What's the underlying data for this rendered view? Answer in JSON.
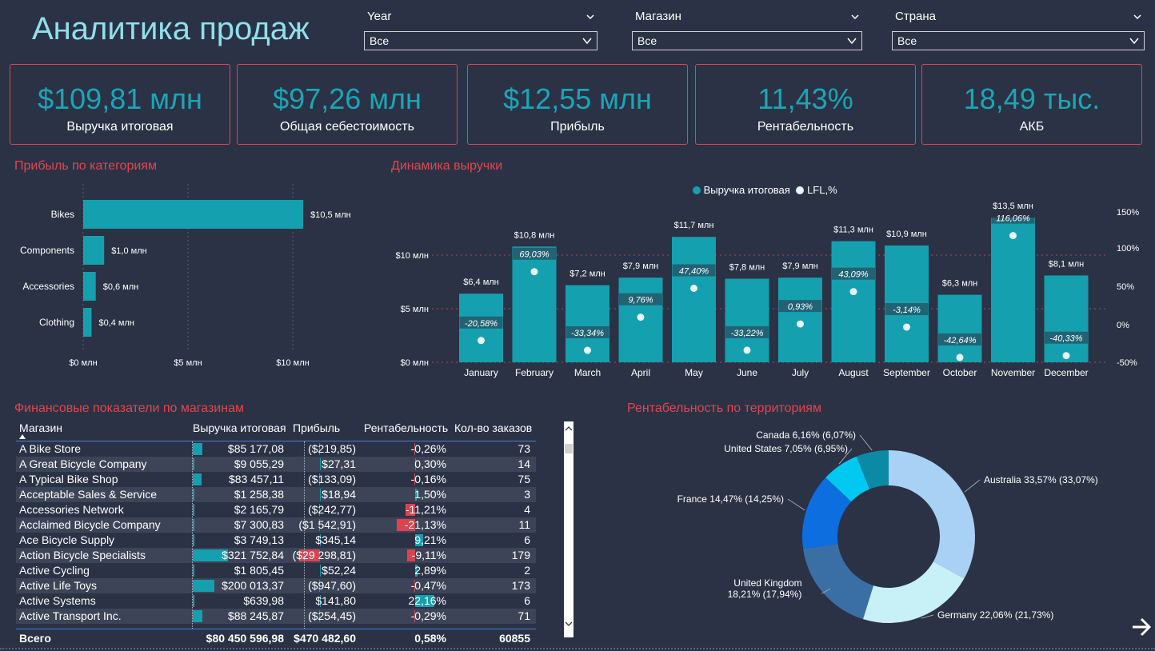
{
  "title": "Аналитика продаж",
  "slicers": [
    {
      "label": "Year",
      "value": "Все"
    },
    {
      "label": "Магазин",
      "value": "Все"
    },
    {
      "label": "Страна",
      "value": "Все"
    }
  ],
  "kpis": [
    {
      "value": "$109,81 млн",
      "label": "Выручка итоговая"
    },
    {
      "value": "$97,26 млн",
      "label": "Общая себестоимость"
    },
    {
      "value": "$12,55 млн",
      "label": "Прибыль"
    },
    {
      "value": "11,43%",
      "label": "Рентабельность"
    },
    {
      "value": "18,49 тыс.",
      "label": "АКБ"
    }
  ],
  "profit_by_category": {
    "title": "Прибыль по категориям",
    "chart_data": {
      "type": "bar",
      "orientation": "horizontal",
      "categories": [
        "Bikes",
        "Components",
        "Accessories",
        "Clothing"
      ],
      "values": [
        10.5,
        1.0,
        0.6,
        0.4
      ],
      "data_labels": [
        "$10,5 млн",
        "$1,0 млн",
        "$0,6 млн",
        "$0,4 млн"
      ],
      "xticks": [
        "$0 млн",
        "$5 млн",
        "$10 млн"
      ],
      "xlim": [
        0,
        10.5
      ],
      "color": "#14a0ae"
    }
  },
  "revenue_dynamics": {
    "title": "Динамика выручки",
    "legend": [
      "Выручка итоговая",
      "LFL,%"
    ],
    "chart_data": {
      "type": "bar",
      "categories": [
        "January",
        "February",
        "March",
        "April",
        "May",
        "June",
        "July",
        "August",
        "September",
        "October",
        "November",
        "December"
      ],
      "series": [
        {
          "name": "Выручка итоговая",
          "values": [
            6.4,
            10.8,
            7.2,
            7.9,
            11.7,
            7.8,
            7.9,
            11.3,
            10.9,
            6.3,
            13.5,
            8.1
          ],
          "labels": [
            "$6,4 млн",
            "$10,8 млн",
            "$7,2 млн",
            "$7,9 млн",
            "$11,7 млн",
            "$7,8 млн",
            "$7,9 млн",
            "$11,3 млн",
            "$10,9 млн",
            "$6,3 млн",
            "$13,5 млн",
            "$8,1 млн"
          ]
        },
        {
          "name": "LFL,%",
          "values": [
            -20.58,
            69.03,
            -33.34,
            9.76,
            47.4,
            -33.22,
            0.93,
            43.09,
            -3.14,
            -42.64,
            116.06,
            -40.33
          ],
          "labels": [
            "-20,58%",
            "69,03%",
            "-33,34%",
            "9,76%",
            "47,40%",
            "-33,22%",
            "0,93%",
            "43,09%",
            "-3,14%",
            "-42,64%",
            "116,06%",
            "-40,33%"
          ]
        }
      ],
      "y_ticks": [
        "$0 млн",
        "$5 млн",
        "$10 млн"
      ],
      "y2_ticks": [
        "-50%",
        "0%",
        "50%",
        "100%",
        "150%"
      ],
      "ylim": [
        0,
        14
      ],
      "y2lim": [
        -50,
        150
      ],
      "colors": {
        "bar": "#14a0ae",
        "point": "#e8f6fb"
      }
    }
  },
  "store_table": {
    "title": "Финансовые показатели по магазинам",
    "columns": [
      "Магазин",
      "Выручка итоговая",
      "Прибыль",
      "Рентабельность",
      "Кол-во заказов"
    ],
    "rows": [
      {
        "store": "A Bike Store",
        "revenue": "$85 177,08",
        "profit": "($219,85)",
        "margin": "-0,26%",
        "orders": "73",
        "rev_v": 85177,
        "prof_v": -219.85,
        "marg_v": -0.26
      },
      {
        "store": "A Great Bicycle Company",
        "revenue": "$9 055,29",
        "profit": "$27,31",
        "margin": "0,30%",
        "orders": "14",
        "rev_v": 9055,
        "prof_v": 27.31,
        "marg_v": 0.3
      },
      {
        "store": "A Typical Bike Shop",
        "revenue": "$83 457,11",
        "profit": "($133,09)",
        "margin": "-0,16%",
        "orders": "75",
        "rev_v": 83457,
        "prof_v": -133.09,
        "marg_v": -0.16
      },
      {
        "store": "Acceptable Sales & Service",
        "revenue": "$1 258,38",
        "profit": "$18,94",
        "margin": "1,50%",
        "orders": "3",
        "rev_v": 1258,
        "prof_v": 18.94,
        "marg_v": 1.5
      },
      {
        "store": "Accessories Network",
        "revenue": "$2 165,79",
        "profit": "($242,77)",
        "margin": "-11,21%",
        "orders": "4",
        "rev_v": 2166,
        "prof_v": -242.77,
        "marg_v": -11.21
      },
      {
        "store": "Acclaimed Bicycle Company",
        "revenue": "$7 300,83",
        "profit": "($1 542,91)",
        "margin": "-21,13%",
        "orders": "11",
        "rev_v": 7301,
        "prof_v": -1542.91,
        "marg_v": -21.13
      },
      {
        "store": "Ace Bicycle Supply",
        "revenue": "$3 749,13",
        "profit": "$345,14",
        "margin": "9,21%",
        "orders": "6",
        "rev_v": 3749,
        "prof_v": 345.14,
        "marg_v": 9.21
      },
      {
        "store": "Action Bicycle Specialists",
        "revenue": "$321 752,84",
        "profit": "($29 298,81)",
        "margin": "-9,11%",
        "orders": "179",
        "rev_v": 321753,
        "prof_v": -29298.81,
        "marg_v": -9.11
      },
      {
        "store": "Active Cycling",
        "revenue": "$1 805,45",
        "profit": "$52,24",
        "margin": "2,89%",
        "orders": "2",
        "rev_v": 1805,
        "prof_v": 52.24,
        "marg_v": 2.89
      },
      {
        "store": "Active Life Toys",
        "revenue": "$200 013,37",
        "profit": "($947,60)",
        "margin": "-0,47%",
        "orders": "173",
        "rev_v": 200013,
        "prof_v": -947.6,
        "marg_v": -0.47
      },
      {
        "store": "Active Systems",
        "revenue": "$639,98",
        "profit": "$141,80",
        "margin": "22,16%",
        "orders": "6",
        "rev_v": 640,
        "prof_v": 141.8,
        "marg_v": 22.16
      },
      {
        "store": "Active Transport Inc.",
        "revenue": "$88 245,87",
        "profit": "($254,45)",
        "margin": "-0,29%",
        "orders": "71",
        "rev_v": 88246,
        "prof_v": -254.45,
        "marg_v": -0.29
      }
    ],
    "totals": {
      "label": "Всего",
      "revenue": "$80 450 596,98",
      "profit": "$470 482,60",
      "margin": "0,58%",
      "orders": "60855"
    },
    "colors": {
      "positive": "#14a0ae",
      "negative": "#d9444f"
    }
  },
  "territory_margin": {
    "title": "Рентабельность по территориям",
    "chart_data": {
      "type": "pie",
      "donut": true,
      "labels": [
        "Australia",
        "Germany",
        "United Kingdom",
        "France",
        "United States",
        "Canada"
      ],
      "values": [
        33.57,
        22.06,
        18.21,
        14.47,
        7.05,
        6.16
      ],
      "secondary": [
        33.07,
        21.73,
        17.94,
        14.25,
        6.95,
        6.07
      ],
      "slice_labels": [
        "Australia 33,57% (33,07%)",
        "Germany 22,06% (21,73%)",
        "United Kingdom",
        "France 14,47% (14,25%)",
        "United States 7,05% (6,95%)",
        "Canada 6,16% (6,07%)"
      ],
      "uk_label_line2": "18,21% (17,94%)",
      "colors": [
        "#a9d0f5",
        "#c7f0f7",
        "#3a6fa6",
        "#0d6ee0",
        "#00c8f0",
        "#0a8aa5"
      ]
    }
  },
  "icons": {
    "next": "arrow-right-icon",
    "scroll_up": "chevron-up-icon",
    "scroll_down": "chevron-down-icon"
  }
}
